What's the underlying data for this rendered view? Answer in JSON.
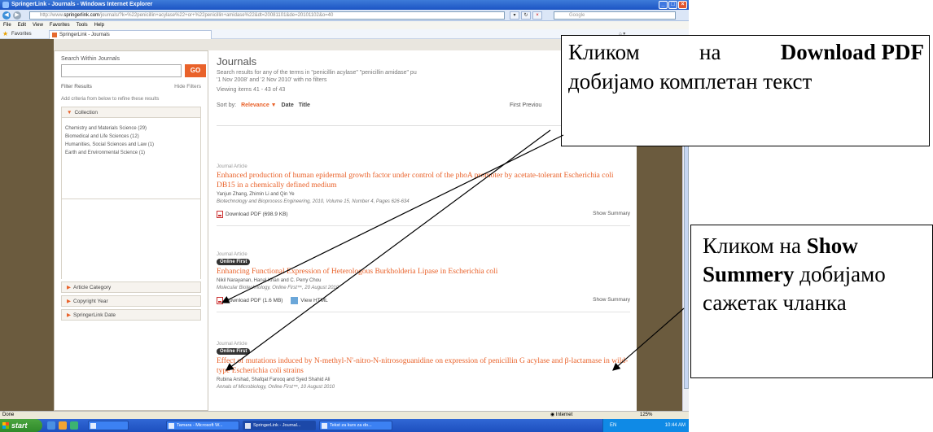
{
  "window": {
    "title": "SpringerLink - Journals - Windows Internet Explorer",
    "controls": [
      "_",
      "□",
      "×"
    ]
  },
  "address_bar": {
    "url_prefix": "http://www.",
    "url_domain": "springerlink.com",
    "url_rest": "/journals/?k=%22penicillin+acylase%22+or+%22penicillin+amidase%22&dt=20081101&de=20101102&o=40",
    "search_placeholder": "Google"
  },
  "menu": [
    "File",
    "Edit",
    "View",
    "Favorites",
    "Tools",
    "Help"
  ],
  "favorites_bar": {
    "favorites_label": "Favorites",
    "tab_label": "SpringerLink - Journals"
  },
  "sidebar": {
    "search_heading": "Search Within Journals",
    "go_label": "GO",
    "filter_results": "Filter Results",
    "hide_filters": "Hide Filters",
    "add_criteria": "Add criteria from below to refine these results",
    "collection_label": "Collection",
    "collection_items": [
      "Chemistry and Materials Science (29)",
      "Biomedical and Life Sciences (12)",
      "Humanities, Social Sciences and Law (1)",
      "Earth and Environmental Science (1)"
    ],
    "facets": [
      "Article Category",
      "Copyright Year",
      "SpringerLink Date"
    ]
  },
  "main": {
    "heading": "Journals",
    "description": "Search results for any of the terms in \"penicillin acylase\" \"penicillin amidase\" pu",
    "description_line2": "'1 Nov 2008' and '2 Nov 2010' with no filters",
    "viewing": "Viewing items 41 - 43 of 43",
    "sort_by": "Sort by:",
    "sort_relevance": "Relevance ▼",
    "sort_date": "Date",
    "sort_title": "Title",
    "pagination": "First  Previou"
  },
  "articles": [
    {
      "type": "Journal Article",
      "badge": "",
      "title": "Enhanced production of human epidermal growth factor under control of the phoA promoter by acetate-tolerant Escherichia coli DB15 in a chemically defined medium",
      "authors": "Yanjun Zhang, Zhimin Li and Qin Ye",
      "journal": "Biotechnology and Bioprocess Engineering, 2010, Volume 15, Number 4, Pages 626-634",
      "download": "Download PDF (698.9 KB)",
      "view_html": "",
      "summary": "Show Summary"
    },
    {
      "type": "Journal Article",
      "badge": "Online First",
      "title": "Enhancing Functional Expression of Heterologous Burkholderia Lipase in Escherichia coli",
      "authors": "Nikil Narayanan, Hanal Khan and C. Perry Chou",
      "journal": "Molecular Biotechnology, Online First™, 20 August 2010",
      "download": "Download PDF (1.6 MB)",
      "view_html": "View HTML",
      "summary": "Show Summary"
    },
    {
      "type": "Journal Article",
      "badge": "Online First",
      "title": "Effect of mutations induced by N-methyl-N'-nitro-N-nitrosoguanidine on expression of penicillin G acylase and β-lactamase in wild-type Escherichia coli strains",
      "authors": "Rubina Arshad, Shafqat Farooq and Syed Shahid Ali",
      "journal": "Annals of Microbiology, Online First™, 10 August 2010",
      "download": "",
      "view_html": "",
      "summary": ""
    }
  ],
  "status_bar": {
    "left": "Done",
    "zone": "Internet",
    "zoom": "125%"
  },
  "taskbar": {
    "start": "start",
    "buttons": [
      "Tamara - Microsoft W...",
      "SpringerLink - Journal...",
      "Tekst za kurs za do..."
    ],
    "clock": "10:44 AM",
    "lang": "EN"
  },
  "callouts": {
    "c1_word1": "Кликом",
    "c1_word2": "на",
    "c1_bold": "Download PDF",
    "c1_line2": "добијамо комплетан текст",
    "c2_text1": "Кликом на ",
    "c2_bold1": "Show",
    "c2_bold2": "Summery",
    "c2_text2": " добијамо",
    "c2_line3": "сажетак чланка"
  }
}
